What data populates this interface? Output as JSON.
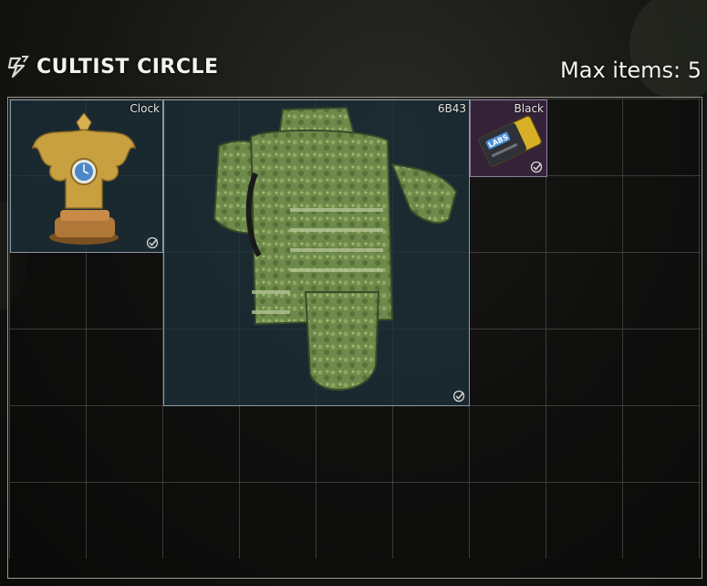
{
  "header": {
    "title": "CULTIST CIRCLE",
    "max_items_label": "Max items: 5",
    "icon": "cultist-sigil-icon"
  },
  "grid": {
    "columns": 9,
    "rows": 6
  },
  "items": [
    {
      "label": "Clock",
      "icon": "double-headed-eagle-clock-icon",
      "status_icon": "found-in-raid-check-icon"
    },
    {
      "label": "6B43",
      "icon": "body-armor-vest-icon",
      "status_icon": "found-in-raid-check-icon"
    },
    {
      "label": "Black",
      "icon": "labs-keycard-icon",
      "card_text": "LABS",
      "status_icon": "found-in-raid-check-icon"
    }
  ],
  "colors": {
    "item_background": "#1e303a",
    "keycard_background": "#3a2640",
    "camo_green": "#6e8a4a",
    "clock_gold": "#c9a040"
  }
}
